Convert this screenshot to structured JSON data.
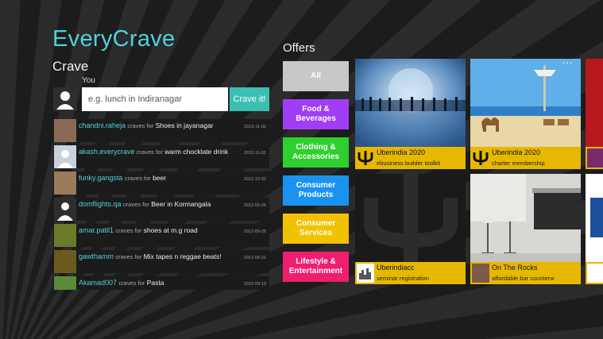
{
  "app": {
    "logo": "EveryCrave"
  },
  "crave": {
    "title": "Crave",
    "you_label": "You",
    "placeholder": "e.g. lunch in Indiranagar",
    "button": "Crave it!"
  },
  "feed": [
    {
      "user": "chandni.raheja",
      "craves": "craves for",
      "item": "Shoes in jayanagar",
      "date": "2012-11-02",
      "avatar_color": "#8a6a55"
    },
    {
      "user": "akash.everycrave",
      "craves": "craves for",
      "item": "warm chocklate drink",
      "date": "2012-11-01",
      "avatar_color": "#c9d2dc"
    },
    {
      "user": "funky.gangsta",
      "craves": "craves for",
      "item": "beer",
      "date": "2012-10-02",
      "avatar_color": "#9a7b5e"
    },
    {
      "user": "domflights.qa",
      "craves": "craves for",
      "item": "Beer in Kormangala",
      "date": "2012-09-26",
      "avatar_color": "#2e2e2e"
    },
    {
      "user": "amar.patil1",
      "craves": "craves for",
      "item": "shoes at m.g road",
      "date": "2012-09-25",
      "avatar_color": "#6b7a2a"
    },
    {
      "user": "gawthamm",
      "craves": "craves for",
      "item": "Mix tapes n reggae beats!",
      "date": "2012-09-21",
      "avatar_color": "#6a5a20"
    },
    {
      "user": "Akamad007",
      "craves": "craves for",
      "item": "Pasta",
      "date": "2012-09-19",
      "avatar_color": "#5b8a3a"
    }
  ],
  "offers": {
    "title": "Offers",
    "categories": [
      {
        "label": "All",
        "color": "#c8c8c8",
        "text_color": "#ffffff"
      },
      {
        "label": "Food & Beverages",
        "color": "#a03ef5",
        "text_color": "#ffffff"
      },
      {
        "label": "Clothing & Accessories",
        "color": "#2ecf2e",
        "text_color": "#ffffff"
      },
      {
        "label": "Consumer Products",
        "color": "#1a93f0",
        "text_color": "#ffffff"
      },
      {
        "label": "Consumer Services",
        "color": "#f2c200",
        "text_color": "#ffffff"
      },
      {
        "label": "Lifestyle & Entertainment",
        "color": "#f01e6e",
        "text_color": "#ffffff"
      }
    ],
    "tiles": [
      {
        "title": "Uberindia 2020",
        "subtitle": "ebusiness builder toolkit",
        "image": "globe-people-image"
      },
      {
        "title": "Uberindia 2020",
        "subtitle": "charter membership",
        "image": "beach-camel-image"
      },
      {
        "title": "Uberindiacc",
        "subtitle": "seminar registration",
        "image": "psi-logo-image"
      },
      {
        "title": "On The Rocks",
        "subtitle": "affordable bar counterw",
        "image": "bar-stools-image"
      }
    ]
  }
}
